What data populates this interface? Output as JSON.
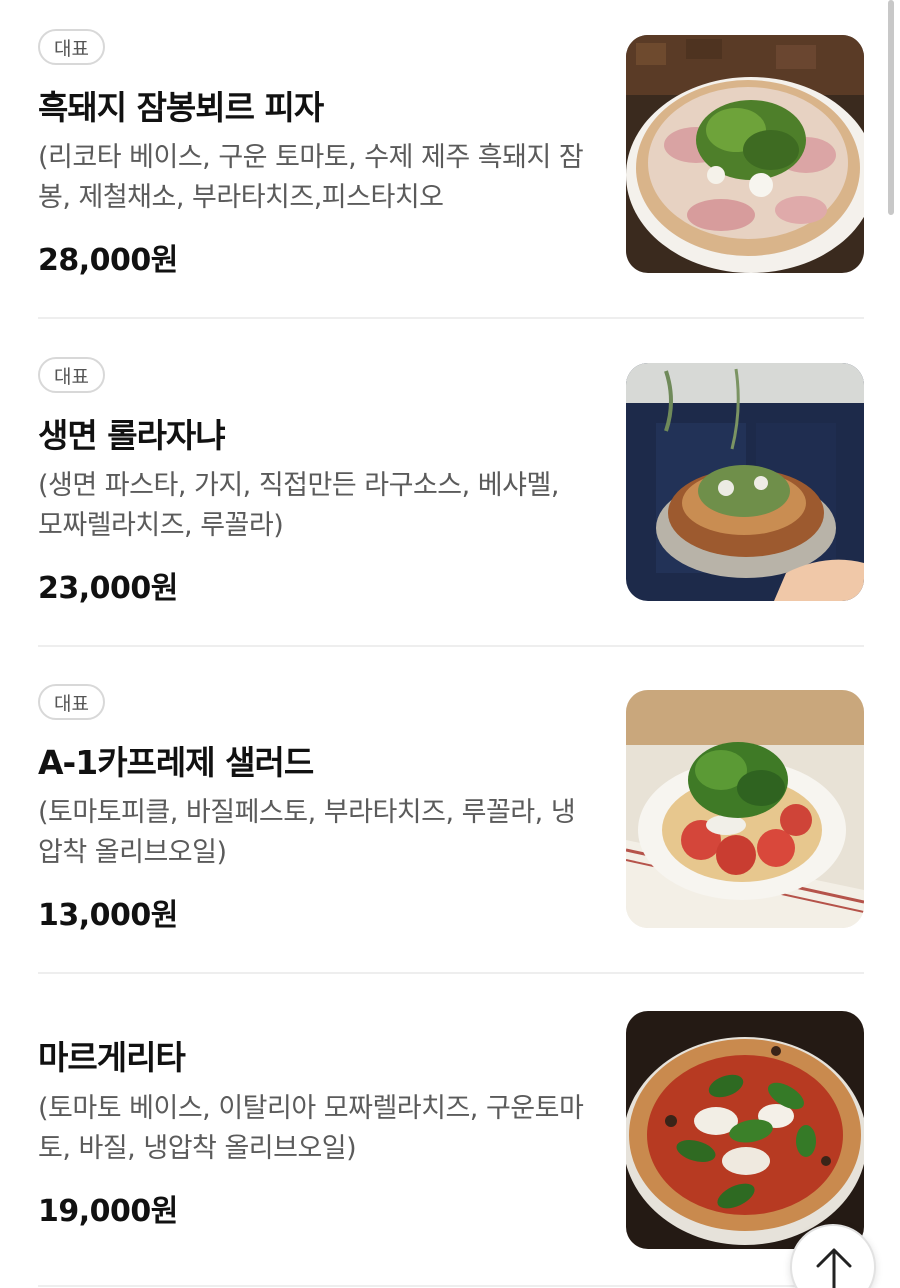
{
  "menu": {
    "items": [
      {
        "badge": "대표",
        "name": "흑돼지 잠봉뵈르 피자",
        "description": "(리코타 베이스, 구운 토마토, 수제 제주 흑돼지 잠봉, 제철채소, 부라타치즈,피스타치오",
        "price": "28,000원",
        "image": "pizza-jambon-photo"
      },
      {
        "badge": "대표",
        "name": "생면 롤라자냐",
        "description": "(생면 파스타, 가지, 직접만든 라구소스, 베샤멜, 모짜렐라치즈, 루꼴라)",
        "price": "23,000원",
        "image": "roll-lasagna-photo"
      },
      {
        "badge": "대표",
        "name": "A-1카프레제 샐러드",
        "description": "(토마토피클, 바질페스토, 부라타치즈, 루꼴라, 냉압착 올리브오일)",
        "price": "13,000원",
        "image": "caprese-salad-photo"
      },
      {
        "name": "마르게리타",
        "description": "(토마토 베이스, 이탈리아 모짜렐라치즈, 구운토마토, 바질, 냉압착 올리브오일)",
        "price": "19,000원",
        "image": "margherita-photo"
      }
    ]
  },
  "controls": {
    "scroll_top_icon": "arrow-up-icon"
  }
}
